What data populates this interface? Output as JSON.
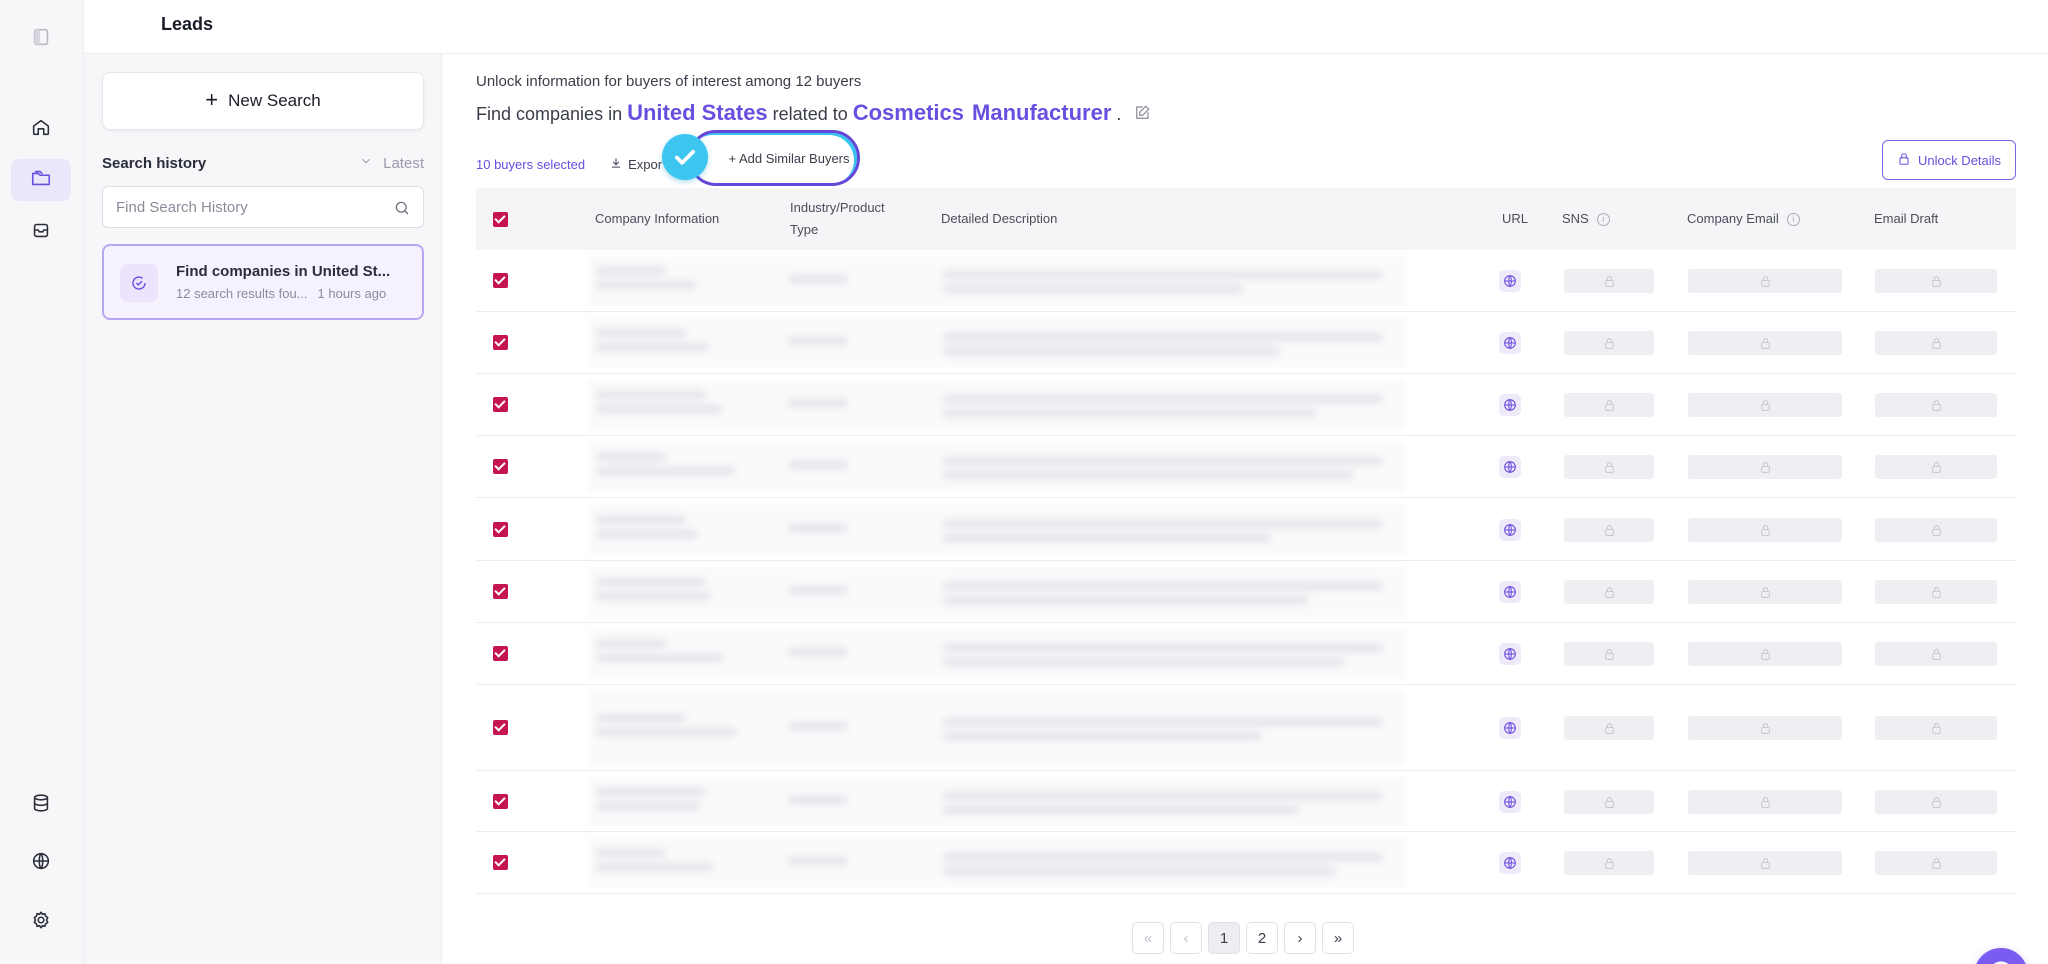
{
  "header": {
    "title": "Leads"
  },
  "rail": {
    "icons": [
      "sidebar-toggle-icon",
      "home-icon",
      "folder-icon",
      "inbox-icon",
      "database-icon",
      "globe-icon",
      "gear-icon"
    ],
    "active": "folder-icon"
  },
  "panel": {
    "new_search_label": "New Search",
    "history_label": "Search history",
    "sort_label": "Latest",
    "search_placeholder": "Find Search History",
    "card": {
      "title": "Find companies in United St...",
      "results": "12 search results fou...",
      "time": "1 hours ago"
    }
  },
  "main": {
    "unlock_info": "Unlock information for buyers of interest among 12 buyers",
    "find_prefix": "Find companies in",
    "country": "United States",
    "related_to": "related to",
    "keyword1": "Cosmetics",
    "keyword2": "Manufacturer",
    "dot": ".",
    "selected_label": "10 buyers selected",
    "export_label": "Expor",
    "add_similar_label": "+ Add Similar Buyers",
    "unlock_details_label": "Unlock Details"
  },
  "table": {
    "columns": {
      "company": "Company Information",
      "industry_line1": "Industry/Product",
      "industry_line2": "Type",
      "description": "Detailed Description",
      "url": "URL",
      "sns": "SNS",
      "email": "Company Email",
      "draft": "Email Draft"
    },
    "row_count": 10,
    "rows_checked": true
  },
  "pagination": {
    "first": "«",
    "prev": "‹",
    "pages": [
      "1",
      "2"
    ],
    "current": "1",
    "next": "›",
    "last": "»"
  },
  "colors": {
    "accent": "#6a4ee0",
    "checkbox": "#c4154f",
    "highlight_ring": "#6446d8",
    "check_bubble": "#3cc5ef"
  }
}
